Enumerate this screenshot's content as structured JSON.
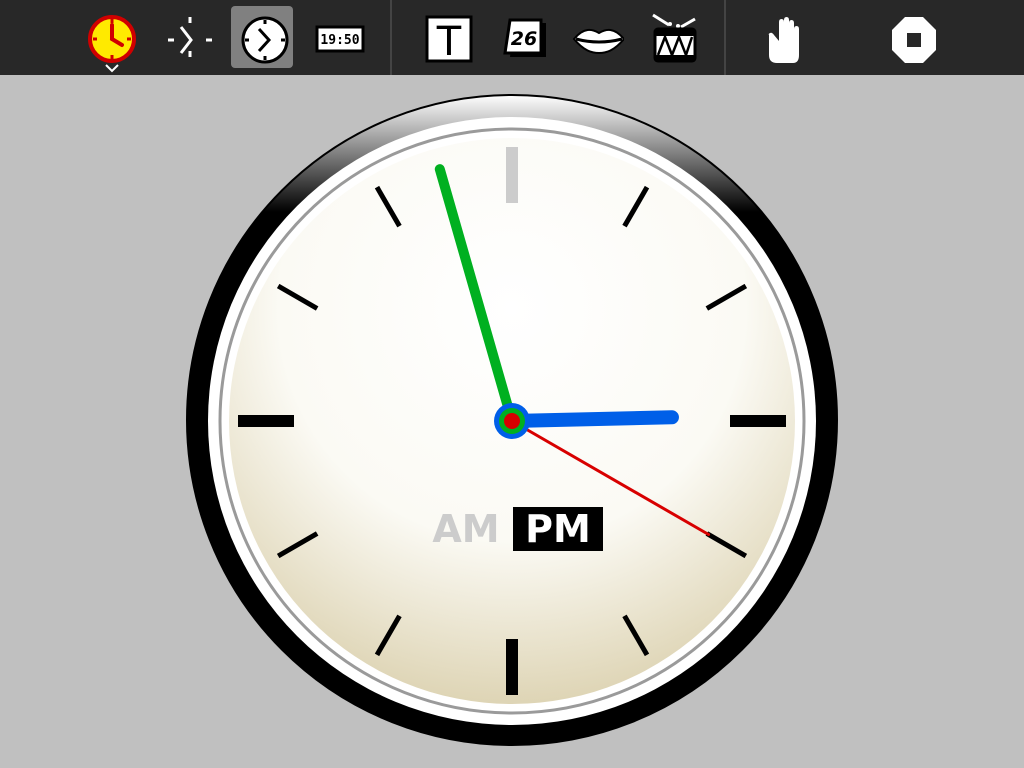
{
  "toolbar": {
    "buttons": [
      {
        "name": "activity-clock-button",
        "icon": "clock-activity-icon"
      },
      {
        "name": "grab-hands-button",
        "icon": "grab-hands-icon"
      },
      {
        "name": "simple-clock-button",
        "icon": "simple-clock-icon",
        "selected": true
      },
      {
        "name": "digital-clock-button",
        "icon": "digital-clock-icon",
        "label": "19:50"
      },
      {
        "name": "write-time-button",
        "icon": "text-T-icon",
        "label": "T"
      },
      {
        "name": "write-date-button",
        "icon": "calendar-date-icon",
        "label": "26"
      },
      {
        "name": "speak-time-button",
        "icon": "lips-icon"
      },
      {
        "name": "tick-sound-button",
        "icon": "drum-icon"
      },
      {
        "name": "grab-button",
        "icon": "hand-icon"
      },
      {
        "name": "stop-button",
        "icon": "stop-icon"
      }
    ]
  },
  "clock": {
    "time": {
      "hour": 14,
      "minute": 57,
      "second": 20
    },
    "hand_colors": {
      "hour": "#005fe8",
      "minute": "#00b020",
      "second": "#d80000"
    },
    "am_label": "AM",
    "pm_label": "PM",
    "period": "PM"
  },
  "colors": {
    "toolbar": "#282828",
    "background": "#c0c0c0",
    "accent": "#ffea00"
  }
}
